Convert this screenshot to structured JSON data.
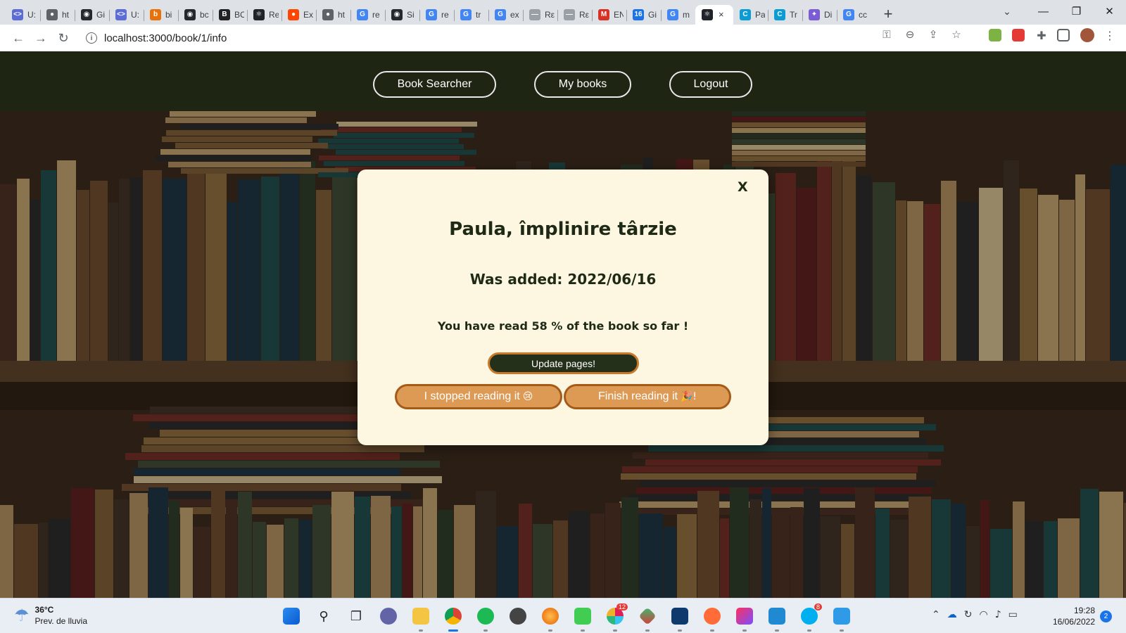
{
  "browser": {
    "tabs": [
      {
        "title": "U:",
        "color": "#5b6cd6",
        "glyph": "<>"
      },
      {
        "title": "ht",
        "color": "#5f6368",
        "glyph": "●"
      },
      {
        "title": "Gi",
        "color": "#24292f",
        "glyph": "◉"
      },
      {
        "title": "U:",
        "color": "#5b6cd6",
        "glyph": "<>"
      },
      {
        "title": "bi",
        "color": "#e8710a",
        "glyph": "b"
      },
      {
        "title": "bc",
        "color": "#24292f",
        "glyph": "◉"
      },
      {
        "title": "BC",
        "color": "#202124",
        "glyph": "B"
      },
      {
        "title": "Re",
        "color": "#20232a",
        "glyph": "⚛"
      },
      {
        "title": "Ex",
        "color": "#ff4500",
        "glyph": "●"
      },
      {
        "title": "ht",
        "color": "#5f6368",
        "glyph": "●"
      },
      {
        "title": "re",
        "color": "#4285f4",
        "glyph": "G"
      },
      {
        "title": "Si",
        "color": "#24292f",
        "glyph": "◉"
      },
      {
        "title": "re",
        "color": "#4285f4",
        "glyph": "G"
      },
      {
        "title": "tr",
        "color": "#4285f4",
        "glyph": "G"
      },
      {
        "title": "ex",
        "color": "#4285f4",
        "glyph": "G"
      },
      {
        "title": "Rε",
        "color": "#9aa0a6",
        "glyph": "—"
      },
      {
        "title": "Rε",
        "color": "#9aa0a6",
        "glyph": "—"
      },
      {
        "title": "EN",
        "color": "#d93025",
        "glyph": "M"
      },
      {
        "title": "Gi",
        "color": "#1a73e8",
        "glyph": "16"
      },
      {
        "title": "m",
        "color": "#4285f4",
        "glyph": "G"
      }
    ],
    "active_tab": {
      "color": "#20232a",
      "glyph": "⚛",
      "close": "×"
    },
    "tabs_after": [
      {
        "title": "Pa",
        "color": "#0b9cd6",
        "glyph": "C"
      },
      {
        "title": "Tr",
        "color": "#0b9cd6",
        "glyph": "C"
      },
      {
        "title": "Di",
        "color": "#7b5bd6",
        "glyph": "✦"
      },
      {
        "title": "cc",
        "color": "#4285f4",
        "glyph": "G"
      }
    ],
    "new_tab": "+",
    "window_controls": {
      "tab_search": "⌄",
      "minimize": "—",
      "maximize": "❐",
      "close": "✕"
    },
    "toolbar": {
      "back": "←",
      "forward": "→",
      "reload": "↻",
      "info": "i"
    },
    "url": "localhost:3000/book/1/info",
    "omni_icons": [
      "⚿",
      "⊖",
      "⇪",
      "☆"
    ]
  },
  "nav": {
    "book_searcher": "Book Searcher",
    "my_books": "My books",
    "logout": "Logout"
  },
  "modal": {
    "close": "X",
    "title": "Paula, împlinire târzie",
    "added": "Was added: 2022/06/16",
    "progress": "You have read 58 % of the book so far !",
    "update_button": "Update pages!",
    "stopped_button": "I stopped reading it",
    "stopped_emoji": "😢",
    "finish_button": "Finish reading it",
    "finish_emoji": "🎉!"
  },
  "taskbar": {
    "temperature": "36°C",
    "weather_text": "Prev. de lluvia",
    "time": "19:28",
    "date": "16/06/2022",
    "notifications": "2",
    "badge_slack": "12",
    "badge_skype": "8"
  },
  "colors": {
    "navbar_bg": "#1e2614",
    "modal_bg": "#fdf7e1",
    "accent_dark": "#25301a",
    "accent_orange": "#dd9a55",
    "accent_orange_border": "#a45b18"
  }
}
